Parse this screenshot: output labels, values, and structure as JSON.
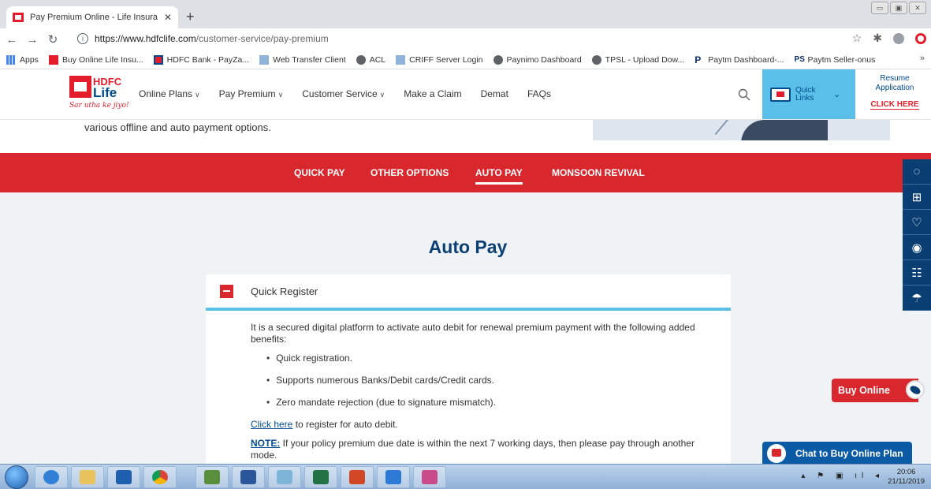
{
  "browser": {
    "tab_title": "Pay Premium Online - Life Insura",
    "tab_close": "✕",
    "new_tab": "+",
    "url_domain": "https://www.hdfclife.com",
    "url_path": "/customer-service/pay-premium",
    "bookmarks": [
      "Apps",
      "Buy Online Life Insu...",
      "HDFC Bank - PayZa...",
      "Web Transfer Client",
      "ACL",
      "CRIFF Server Login",
      "Paynimo Dashboard",
      "TPSL - Upload Dow...",
      "Paytm Dashboard-...",
      "Paytm Seller-onus"
    ],
    "bookmarks_more": "»"
  },
  "header": {
    "logo_hdfc": "HDFC",
    "logo_life": "Life",
    "logo_tagline": "Sar utha ke jiyo!",
    "nav": [
      "Online Plans",
      "Pay Premium",
      "Customer Service",
      "Make a Claim",
      "Demat",
      "FAQs"
    ],
    "quick_links": "Quick Links",
    "resume_line1": "Resume",
    "resume_line2": "Application",
    "resume_cta": "CLICK HERE"
  },
  "hero": {
    "text": "various offline and auto payment options."
  },
  "tabs": [
    "QUICK PAY",
    "OTHER OPTIONS",
    "AUTO PAY",
    "MONSOON REVIVAL"
  ],
  "active_tab": "AUTO PAY",
  "main": {
    "title": "Auto Pay",
    "accordion_title": "Quick Register",
    "intro": "It is a secured digital platform to activate auto debit for renewal premium payment with the following added benefits:",
    "benefits": [
      "Quick registration.",
      "Supports numerous Banks/Debit cards/Credit cards.",
      "Zero mandate rejection (due to signature mismatch)."
    ],
    "click_here": "Click here",
    "register_text": " to register for auto debit.",
    "note_label": "NOTE:",
    "note_text": " If your policy premium due date is within the next 7 working days, then please pay through another mode."
  },
  "widgets": {
    "buy_online": "Buy Online",
    "chat": "Chat to Buy Online Plan"
  },
  "taskbar": {
    "time": "20:06",
    "date": "21/11/2019"
  },
  "colors": {
    "brand_red": "#d9272e",
    "brand_blue": "#0b3f74",
    "accent_cyan": "#5bc0e9"
  }
}
